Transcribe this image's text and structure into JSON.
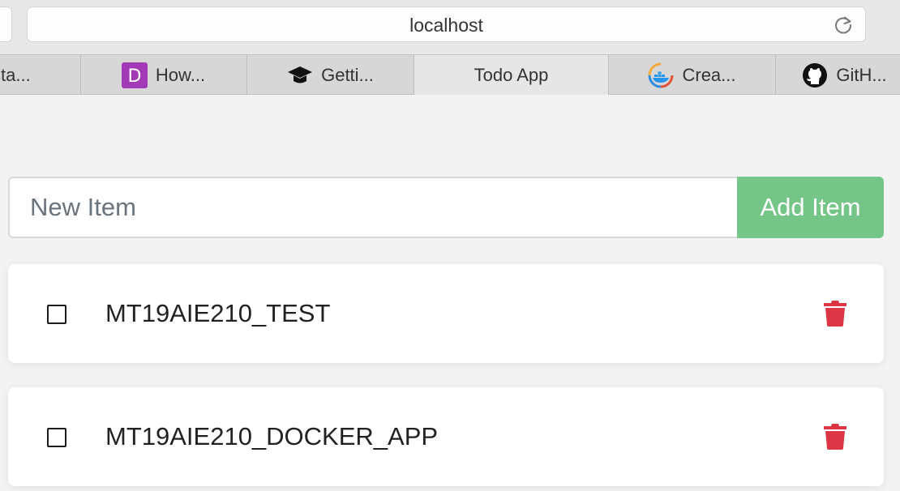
{
  "browser": {
    "url": "localhost",
    "tabs": [
      {
        "label": "sta...",
        "icon": "partial-tab-icon"
      },
      {
        "label": "How...",
        "icon": "purple-d-icon"
      },
      {
        "label": "Getti...",
        "icon": "graduation-cap-icon"
      },
      {
        "label": "Todo App",
        "icon": "",
        "active": true
      },
      {
        "label": "Crea...",
        "icon": "docker-icon"
      },
      {
        "label": "GitH...",
        "icon": "github-icon"
      }
    ]
  },
  "app": {
    "new_item_placeholder": "New Item",
    "add_button_label": "Add Item",
    "items": [
      {
        "name": "MT19AIE210_TEST",
        "completed": false
      },
      {
        "name": "MT19AIE210_DOCKER_APP",
        "completed": false
      }
    ]
  },
  "colors": {
    "add_button": "#76c588",
    "delete_icon": "#dc3545"
  }
}
